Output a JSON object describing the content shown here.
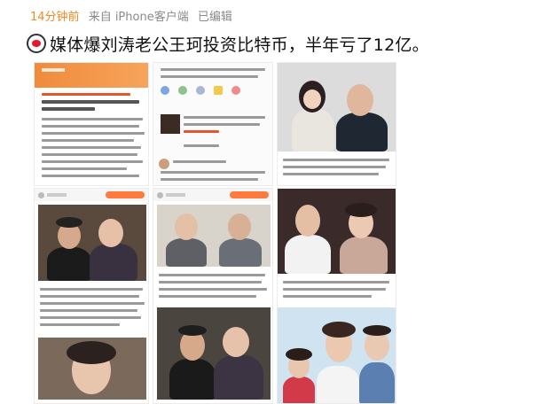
{
  "meta": {
    "time": "14分钟前",
    "source": "来自 iPhone客户端",
    "edited": "已编辑"
  },
  "headline": {
    "title": "媒体爆刘涛老公王珂投资比特币，半年亏了12亿。"
  },
  "colors": {
    "accent": "#f08a24",
    "headline": "#111111",
    "meta": "#8a8a8a",
    "brand_red": "#e6162d",
    "orange": "#ff7a3d"
  },
  "icons": {
    "logo": "weibo-logo-icon"
  }
}
